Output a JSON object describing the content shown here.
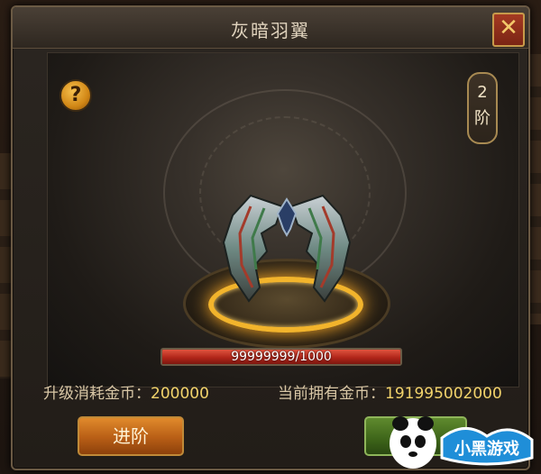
{
  "dialog": {
    "title": "灰暗羽翼",
    "close_icon": "close-icon"
  },
  "help": {
    "icon": "question-icon",
    "label": "?"
  },
  "tier": {
    "number": "2",
    "unit": "阶"
  },
  "progress": {
    "text": "99999999/1000",
    "fill": 1.0
  },
  "costs": {
    "upgrade_label": "升级消耗金币：",
    "upgrade_value": "200000",
    "owned_label": "当前拥有金币：",
    "owned_value": "191995002000"
  },
  "buttons": {
    "advance_label": "进阶",
    "second_label": "一"
  },
  "colors": {
    "title_text": "#e0d3bd",
    "cost_value": "#f2d36b",
    "progress_fill": "#b1261a",
    "advance_button": "#b85e16",
    "second_button": "#3d6419",
    "pedestal_glow": "#f2b42c"
  }
}
